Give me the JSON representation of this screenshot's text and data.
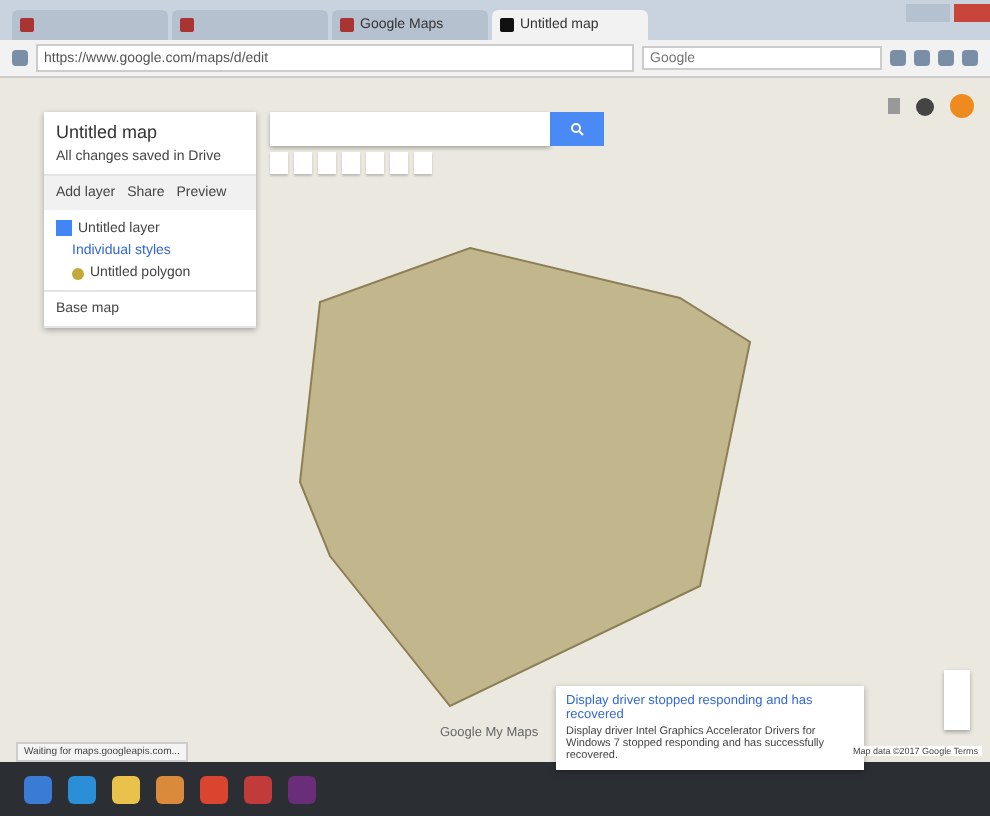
{
  "browser": {
    "tabs": [
      {
        "selected": false
      },
      {
        "selected": false
      },
      {
        "label": "Google Maps",
        "selected": false
      },
      {
        "label": "Untitled map",
        "selected": true
      }
    ],
    "address": "https://www.google.com/maps/d/edit",
    "search": {
      "placeholder": "Google"
    }
  },
  "map_panel": {
    "title": "Untitled map",
    "subtitle": "All changes saved in Drive",
    "actions": [
      "Add layer",
      "Share",
      "Preview"
    ],
    "layers": [
      {
        "name": "Untitled layer",
        "checked": true,
        "style": "Individual styles",
        "features": [
          "Untitled polygon"
        ]
      }
    ],
    "base_map": "Base map"
  },
  "notification": {
    "title": "Display driver stopped responding and has recovered",
    "body": "Display driver Intel Graphics Accelerator Drivers for Windows 7 stopped responding and has successfully recovered."
  },
  "attribution": "Map data ©2017 Google  Terms",
  "logo": "Google My Maps",
  "status_text": "Waiting for maps.googleapis.com..."
}
